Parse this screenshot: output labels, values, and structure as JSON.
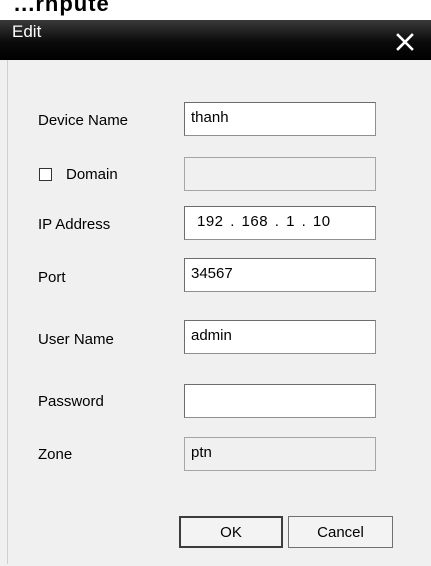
{
  "window": {
    "title": "Edit",
    "behind_text": "...rnpute"
  },
  "form": {
    "device_name": {
      "label": "Device Name",
      "value": "thanh"
    },
    "domain": {
      "label": "Domain",
      "checked": false,
      "value": ""
    },
    "ip_address": {
      "label": "IP Address",
      "octets": [
        "192",
        "168",
        "1",
        "10"
      ]
    },
    "port": {
      "label": "Port",
      "value": "34567"
    },
    "user_name": {
      "label": "User Name",
      "value": "admin"
    },
    "password": {
      "label": "Password",
      "value": ""
    },
    "zone": {
      "label": "Zone",
      "value": "ptn"
    }
  },
  "buttons": {
    "ok": "OK",
    "cancel": "Cancel"
  },
  "icons": {
    "close": "close-icon"
  }
}
